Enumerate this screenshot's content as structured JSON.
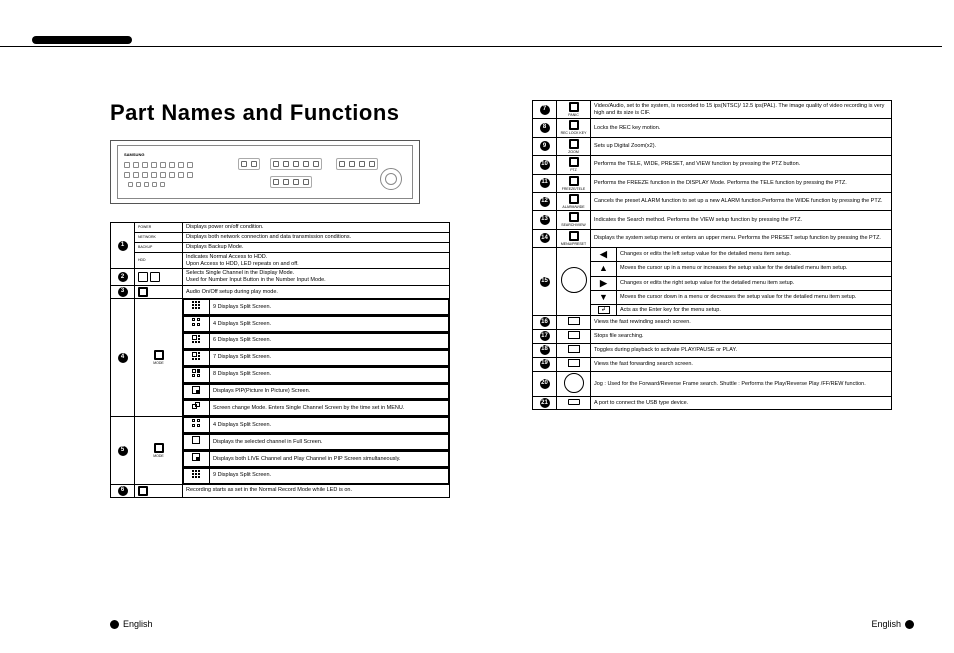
{
  "title": "Part Names and Functions",
  "device_brand": "SAMSUNG",
  "footer": "English",
  "left_table": {
    "row1": {
      "r1": "Displays power on/off condition.",
      "r2": "Displays both network connection and data transmission conditions.",
      "r3": "Displays Backup Mode.",
      "r4a": "Indicates Normal Access to HDD.",
      "r4b": "Upon Access to HDD, LED repeats on and off.",
      "l1": "POWER",
      "l2": "NETWORK",
      "l3": "BACKUP",
      "l4": "HDD"
    },
    "row2": {
      "d1": "Selects Single Channel in the Display Mode.",
      "d2": "Used for Number Input Button in the Number Input Mode."
    },
    "row3": {
      "d": "Audio On/Off setup during play mode."
    },
    "row4": {
      "label": "MODE",
      "s1": "9 Displays Split Screen.",
      "s2": "4 Displays Split Screen.",
      "s3": "6 Displays Split Screen.",
      "s4": "7 Displays Split Screen.",
      "s5": "8 Displays Split Screen.",
      "s6": "Displays PIP(Picture In Picture) Screen.",
      "s7": "Screen change Mode. Enters Single Channel Screen by the time set in MENU."
    },
    "row5": {
      "label": "MODE",
      "s1": "4 Displays Split Screen.",
      "s2": "Displays the selected channel in Full Screen.",
      "s3": "Displays both LIVE Channel and Play Channel in PIP Screen simultaneously.",
      "s4": "9 Displays Split Screen."
    },
    "row6": {
      "d": "Recording starts as set in the Normal Record Mode while LED is on."
    }
  },
  "right_table": {
    "r7": {
      "label": "PANIC",
      "d": "Video/Audio, set to the system, is recorded to 15 ips(NTSC)/ 12.5 ips(PAL). The image quality of video recording is very high and its size is CIF."
    },
    "r8": {
      "label": "REC LOCK KEY",
      "d": "Locks the REC key motion."
    },
    "r9": {
      "label": "ZOOM",
      "d": "Sets up Digital Zoom(x2)."
    },
    "r10": {
      "label": "PTZ",
      "d": "Performs the TELE, WIDE, PRESET, and VIEW function by pressing the PTZ button."
    },
    "r11": {
      "label": "FREEZE/TELE",
      "d": "Performs the FREEZE function in the DISPLAY Mode. Performs the TELE function by pressing the PTZ."
    },
    "r12": {
      "label": "ALARM/WIDE",
      "d": "Cancels the preset ALARM function to set up a new ALARM function.Performs the WIDE function by pressing the PTZ."
    },
    "r13": {
      "label": "SEARCH/VIEW",
      "d": "Indicates the Search method. Performs the VIEW setup function by pressing the PTZ."
    },
    "r14": {
      "label": "MENU/PRESET",
      "d": "Displays the system setup menu or enters an upper menu. Performs the PRESET setup function by pressing the PTZ."
    },
    "r15": {
      "a1": "Changes or edits the left setup value for the detailed menu item setup.",
      "a2": "Moves the cursor up in a menu or increases the setup value for the detailed menu item setup.",
      "a3": "Changes or edits the right setup value for the detailed menu item setup.",
      "a4": "Moves the cursor down in a menu or decreases the setup value for the detailed menu item setup.",
      "a5": "Acts as the Enter key for the menu setup."
    },
    "r16": {
      "d": "Views the fast rewinding search screen."
    },
    "r17": {
      "d": "Stops file searching."
    },
    "r18": {
      "d": "Toggles during playback to activate PLAY/PAUSE or PLAY."
    },
    "r19": {
      "d": "Views the fast forwarding search screen."
    },
    "r20": {
      "d": "Jog : Used for the Forward/Reverse Frame search. Shuttle : Performs the Play/Reverse Play /FF/REW function."
    },
    "r21": {
      "d": "A port to connect the USB type device."
    }
  }
}
